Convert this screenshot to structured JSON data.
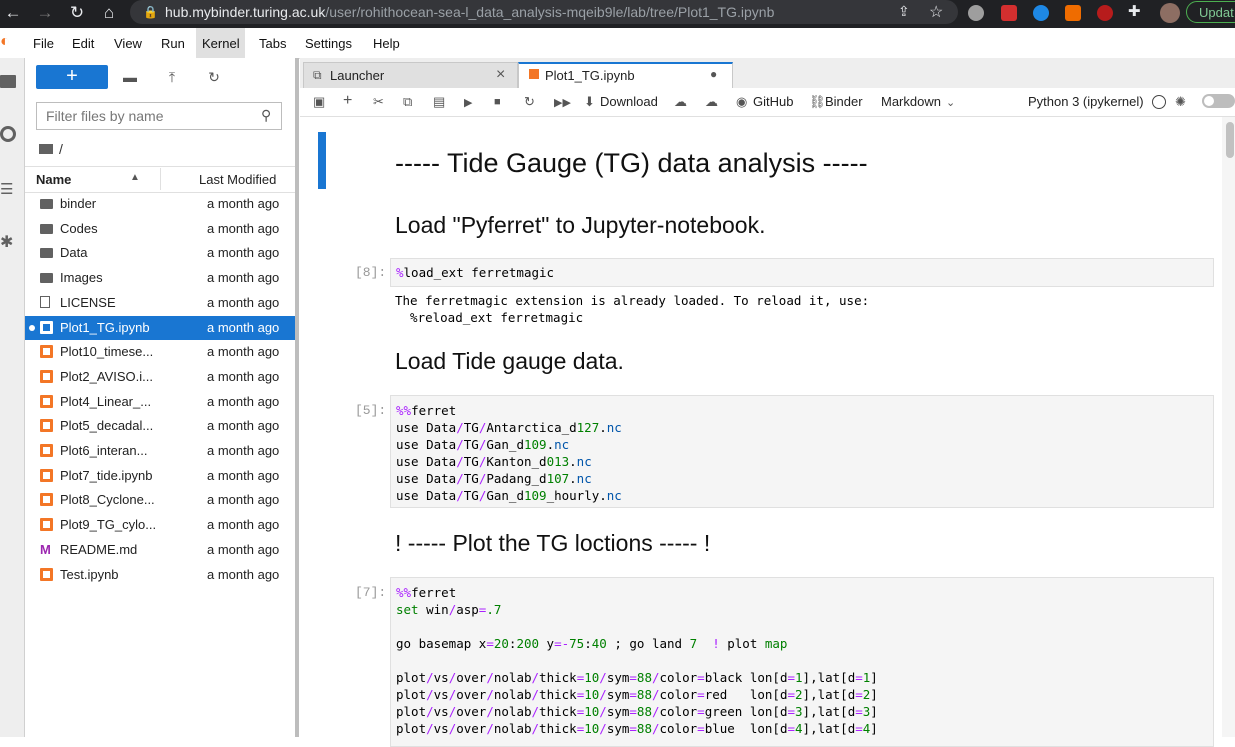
{
  "browser": {
    "url_host": "hub.mybinder.turing.ac.uk",
    "url_path": "/user/rohithocean-sea-l_data_analysis-mqeib9le/lab/tree/Plot1_TG.ipynb",
    "update_label": "Updat"
  },
  "menu": [
    "File",
    "Edit",
    "View",
    "Run",
    "Kernel",
    "Tabs",
    "Settings",
    "Help"
  ],
  "filebrowser": {
    "new_label": "+",
    "filter_placeholder": "Filter files by name",
    "breadcrumb": "/",
    "col_name": "Name",
    "col_modified": "Last Modified",
    "files": [
      {
        "name": "binder",
        "modified": "a month ago",
        "type": "folder"
      },
      {
        "name": "Codes",
        "modified": "a month ago",
        "type": "folder"
      },
      {
        "name": "Data",
        "modified": "a month ago",
        "type": "folder"
      },
      {
        "name": "Images",
        "modified": "a month ago",
        "type": "folder"
      },
      {
        "name": "LICENSE",
        "modified": "a month ago",
        "type": "file"
      },
      {
        "name": "Plot1_TG.ipynb",
        "modified": "a month ago",
        "type": "notebook",
        "selected": true
      },
      {
        "name": "Plot10_timese...",
        "modified": "a month ago",
        "type": "notebook"
      },
      {
        "name": "Plot2_AVISO.i...",
        "modified": "a month ago",
        "type": "notebook"
      },
      {
        "name": "Plot4_Linear_...",
        "modified": "a month ago",
        "type": "notebook"
      },
      {
        "name": "Plot5_decadal...",
        "modified": "a month ago",
        "type": "notebook"
      },
      {
        "name": "Plot6_interan...",
        "modified": "a month ago",
        "type": "notebook"
      },
      {
        "name": "Plot7_tide.ipynb",
        "modified": "a month ago",
        "type": "notebook"
      },
      {
        "name": "Plot8_Cyclone...",
        "modified": "a month ago",
        "type": "notebook"
      },
      {
        "name": "Plot9_TG_cylo...",
        "modified": "a month ago",
        "type": "notebook"
      },
      {
        "name": "README.md",
        "modified": "a month ago",
        "type": "markdown"
      },
      {
        "name": "Test.ipynb",
        "modified": "a month ago",
        "type": "notebook"
      }
    ]
  },
  "tabs": [
    {
      "label": "Launcher",
      "close": "×"
    },
    {
      "label": "Plot1_TG.ipynb",
      "close": "●"
    }
  ],
  "toolbar": {
    "download": "Download",
    "github": "GitHub",
    "binder": "Binder",
    "cell_type": "Markdown",
    "kernel": "Python 3 (ipykernel)"
  },
  "notebook": {
    "title": "----- Tide Gauge (TG) data analysis -----",
    "h_load_ferret": "Load \"Pyferret\" to Jupyter-notebook.",
    "cell1_prompt": "[8]:",
    "cell1_code": "%load_ext ferretmagic",
    "cell1_out1": "The ferretmagic extension is already loaded. To reload it, use:",
    "cell1_out2": "  %reload_ext ferretmagic",
    "h_load_tg": "Load Tide gauge data.",
    "cell2_prompt": "[5]:",
    "cell2_lines": [
      "%%ferret",
      "use Data/TG/Antarctica_d127.nc",
      "use Data/TG/Gan_d109.nc",
      "use Data/TG/Kanton_d013.nc",
      "use Data/TG/Padang_d107.nc",
      "use Data/TG/Gan_d109_hourly.nc"
    ],
    "h_plot": "! ----- Plot the TG loctions ----- !",
    "cell3_prompt": "[7]:",
    "cell3_lines": [
      "%%ferret",
      "set win/asp=.7",
      "",
      "go basemap x=20:200 y=-75:40 ; go land 7  ! plot map",
      "",
      "plot/vs/over/nolab/thick=10/sym=88/color=black lon[d=1],lat[d=1]",
      "plot/vs/over/nolab/thick=10/sym=88/color=red   lon[d=2],lat[d=2]",
      "plot/vs/over/nolab/thick=10/sym=88/color=green lon[d=3],lat[d=3]",
      "plot/vs/over/nolab/thick=10/sym=88/color=blue  lon[d=4],lat[d=4]"
    ]
  }
}
